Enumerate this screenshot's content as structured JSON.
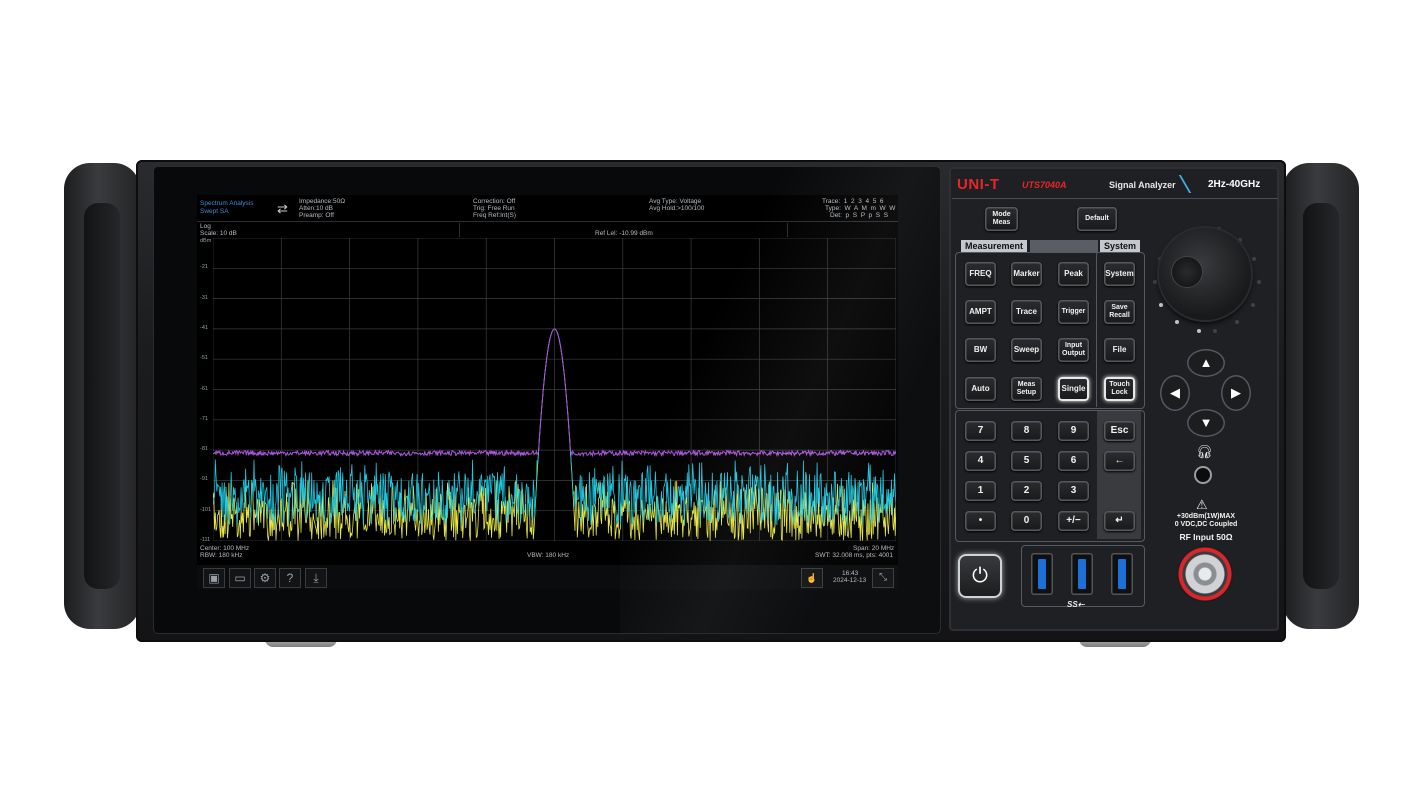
{
  "brand": {
    "logo": "UNI-T",
    "model": "UTS7040A",
    "product": "Signal Analyzer",
    "range": "2Hz-40GHz"
  },
  "screen": {
    "mode": "Spectrum Analysis",
    "mode_sub": "Swept SA",
    "impedance": "Impedance:50Ω",
    "atten": "Atten:10 dB",
    "preamp": "Preamp: Off",
    "correction": "Correction: Off",
    "trig": "Trig: Free Run",
    "freq_ref": "Freq Ref:Int(S)",
    "avg_type": "Avg Type: Voltage",
    "avg_hold": "Avg|Hold:>100/100",
    "trace_row": "Trace:  1  2  3  4  5  6",
    "type_row": "Type:  W  A  M  m  W  W",
    "det_row": "Det:  p  S  P  p  S  S",
    "log": "Log",
    "scale": "Scale: 10 dB",
    "ref_lvl": "Ref Lel: -10.99 dBm",
    "unit": "dBm",
    "y_ticks": [
      "-21",
      "-31",
      "-41",
      "-51",
      "-61",
      "-71",
      "-81",
      "-91",
      "-101",
      "-111"
    ],
    "center": "Center: 100 MHz",
    "rbw": "RBW: 180 kHz",
    "vbw": "VBW: 180 kHz",
    "span": "Span: 20 MHz",
    "swt": "SWT: 32.008 ms, pts: 4001",
    "time": "16:43",
    "date": "2024-12-13"
  },
  "chart_data": {
    "type": "line",
    "xlabel": "",
    "ylabel": "",
    "ylim": [
      -111,
      -11
    ],
    "x_range_mhz": [
      90,
      110
    ],
    "series": [
      {
        "color": "#a855d8",
        "noise_floor_dbm": -82,
        "peak_dbm": -41,
        "peak_mhz": 100
      },
      {
        "color": "#1ec8e0",
        "noise_floor_dbm": -88,
        "peak_dbm": -41,
        "peak_mhz": 100
      },
      {
        "color": "#e6e645",
        "noise_floor_dbm": -97,
        "peak_dbm": -41,
        "peak_mhz": 100
      }
    ]
  },
  "panel": {
    "mode_meas": [
      "Mode",
      "Meas"
    ],
    "default": "Default",
    "measurement": "Measurement",
    "system": "System",
    "rows": [
      [
        "FREQ",
        "Marker",
        "Peak",
        "System"
      ],
      [
        "AMPT",
        "Trace",
        "Trigger",
        "Save|Recall"
      ],
      [
        "BW",
        "Sweep",
        "Input|Output",
        "File"
      ],
      [
        "Auto",
        "Meas|Setup",
        "Single",
        "Touch|Lock"
      ]
    ],
    "numpad": [
      [
        "7",
        "8",
        "9",
        "Esc"
      ],
      [
        "4",
        "5",
        "6",
        "←"
      ],
      [
        "1",
        "2",
        "3",
        ""
      ],
      [
        "•",
        "0",
        "+/−",
        "↵"
      ]
    ],
    "warning": "+30dBm(1W)MAX",
    "coupling": "0 VDC,DC Coupled",
    "rf_input": "RF Input  50Ω",
    "usb_label": "SS⇠"
  },
  "colors": {
    "accent": "#3b8fd8",
    "logo": "#e8262a",
    "trace_purple": "#a855d8",
    "trace_cyan": "#1ec8e0",
    "trace_yellow": "#e6e645"
  }
}
